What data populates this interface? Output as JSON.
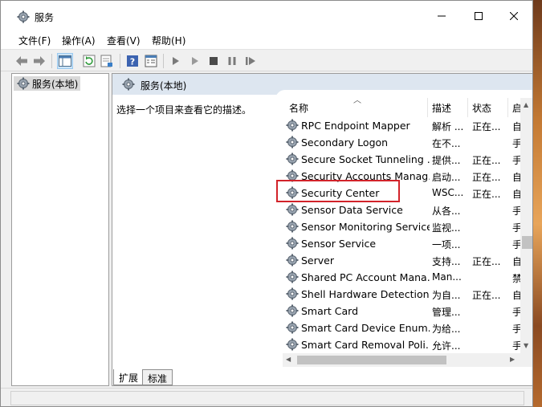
{
  "window": {
    "title": "服务"
  },
  "menu": {
    "file": "文件(F)",
    "action": "操作(A)",
    "view": "查看(V)",
    "help": "帮助(H)"
  },
  "tree": {
    "root_label": "服务(本地)"
  },
  "content": {
    "header_title": "服务(本地)",
    "description_prompt": "选择一个项目来查看它的描述。"
  },
  "columns": {
    "name": "名称",
    "desc": "描述",
    "status": "状态",
    "start": "启"
  },
  "services": [
    {
      "name": "RPC Endpoint Mapper",
      "desc": "解析 ...",
      "status": "正在...",
      "start": "自"
    },
    {
      "name": "Secondary Logon",
      "desc": "在不...",
      "status": "",
      "start": "手"
    },
    {
      "name": "Secure Socket Tunneling ...",
      "desc": "提供...",
      "status": "正在...",
      "start": "手"
    },
    {
      "name": "Security Accounts Manag...",
      "desc": "启动...",
      "status": "正在...",
      "start": "自"
    },
    {
      "name": "Security Center",
      "desc": "WSC...",
      "status": "正在...",
      "start": "自"
    },
    {
      "name": "Sensor Data Service",
      "desc": "从各...",
      "status": "",
      "start": "手"
    },
    {
      "name": "Sensor Monitoring Service",
      "desc": "监视...",
      "status": "",
      "start": "手"
    },
    {
      "name": "Sensor Service",
      "desc": "一项...",
      "status": "",
      "start": "手"
    },
    {
      "name": "Server",
      "desc": "支持...",
      "status": "正在...",
      "start": "自"
    },
    {
      "name": "Shared PC Account Mana...",
      "desc": "Man...",
      "status": "",
      "start": "禁"
    },
    {
      "name": "Shell Hardware Detection",
      "desc": "为自...",
      "status": "正在...",
      "start": "自"
    },
    {
      "name": "Smart Card",
      "desc": "管理...",
      "status": "",
      "start": "手"
    },
    {
      "name": "Smart Card Device Enum...",
      "desc": "为给...",
      "status": "",
      "start": "手"
    },
    {
      "name": "Smart Card Removal Poli...",
      "desc": "允许...",
      "status": "",
      "start": "手"
    }
  ],
  "highlighted_service": "Security Center",
  "tabs": {
    "extended": "扩展",
    "standard": "标准"
  },
  "colors": {
    "highlight_border": "#d2232a",
    "header_bg": "#dde6f0",
    "accent": "#2b7bd3"
  }
}
